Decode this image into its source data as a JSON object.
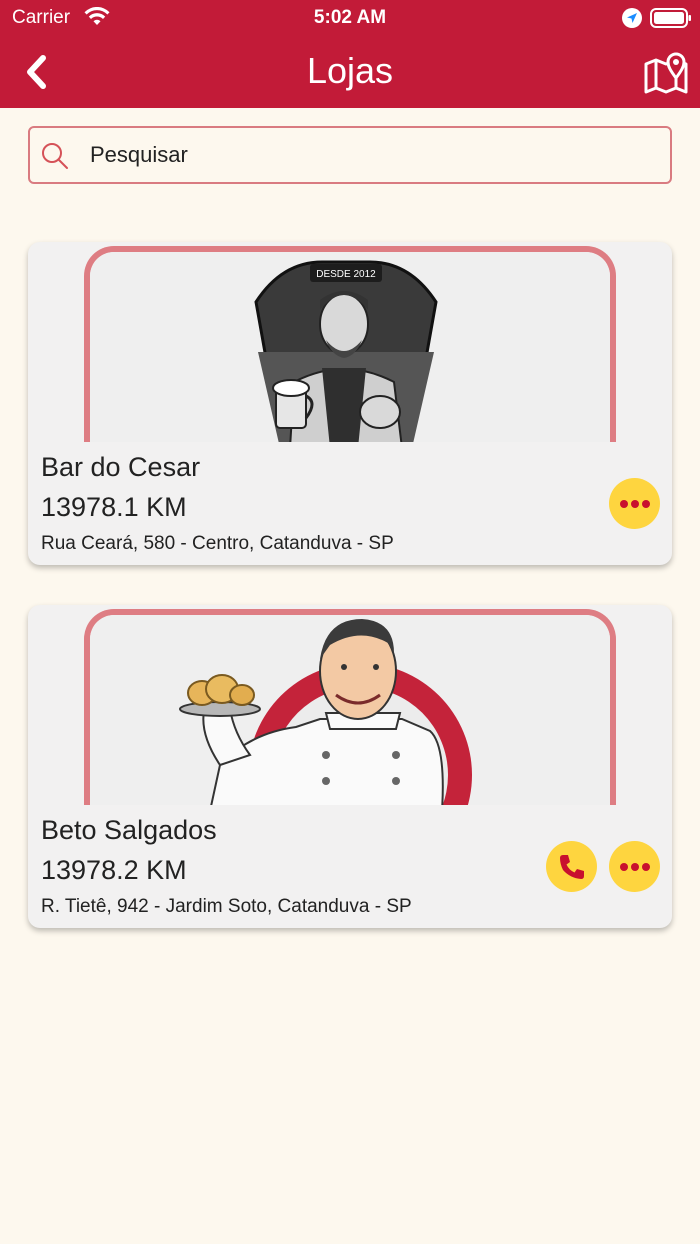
{
  "status_bar": {
    "carrier": "Carrier",
    "time": "5:02 AM"
  },
  "nav": {
    "title": "Lojas",
    "back_icon": "chevron-left-icon",
    "map_icon": "map-pin-icon"
  },
  "search": {
    "placeholder": "Pesquisar",
    "value": ""
  },
  "colors": {
    "brand": "#c21b38",
    "accent": "#fed53f",
    "background": "#fdf8ee",
    "card": "#f2f1f1",
    "frame": "#de7d83"
  },
  "stores": [
    {
      "name": "Bar do Cesar",
      "distance": "13978.1 KM",
      "address": "Rua Ceará, 580 - Centro, Catanduva - SP",
      "logo_text": "DESDE 2012",
      "has_phone": false
    },
    {
      "name": "Beto Salgados",
      "distance": "13978.2 KM",
      "address": "R. Tietê, 942 - Jardim Soto, Catanduva - SP",
      "has_phone": true
    }
  ]
}
